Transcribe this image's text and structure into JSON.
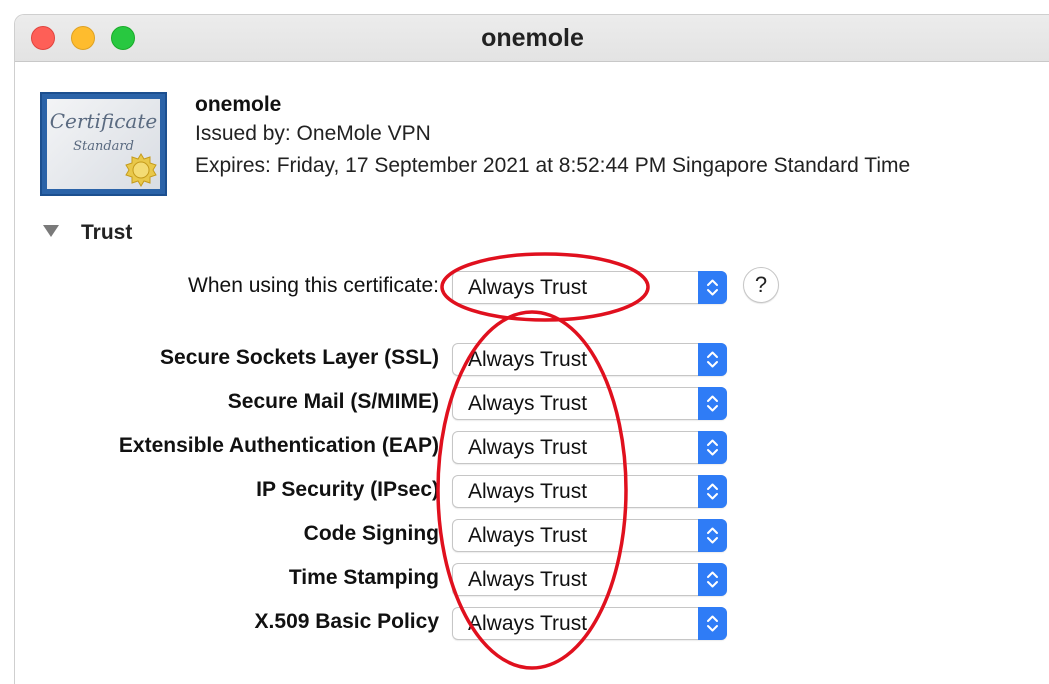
{
  "window": {
    "title": "onemole"
  },
  "certificate": {
    "icon_text_main": "Certificate",
    "icon_text_sub": "Standard",
    "name": "onemole",
    "issued_by": "Issued by: OneMole VPN",
    "expires": "Expires: Friday, 17 September 2021 at 8:52:44 PM Singapore Standard Time"
  },
  "trust": {
    "section_label": "Trust",
    "when_using_label": "When using this certificate:",
    "when_using_value": "Always Trust",
    "help_label": "?",
    "policies": [
      {
        "label": "Secure Sockets Layer (SSL)",
        "value": "Always Trust"
      },
      {
        "label": "Secure Mail (S/MIME)",
        "value": "Always Trust"
      },
      {
        "label": "Extensible Authentication (EAP)",
        "value": "Always Trust"
      },
      {
        "label": "IP Security (IPsec)",
        "value": "Always Trust"
      },
      {
        "label": "Code Signing",
        "value": "Always Trust"
      },
      {
        "label": "Time Stamping",
        "value": "Always Trust"
      },
      {
        "label": "X.509 Basic Policy",
        "value": "Always Trust"
      }
    ]
  },
  "colors": {
    "accent": "#2f7cf6",
    "annotation": "#e0101e"
  }
}
